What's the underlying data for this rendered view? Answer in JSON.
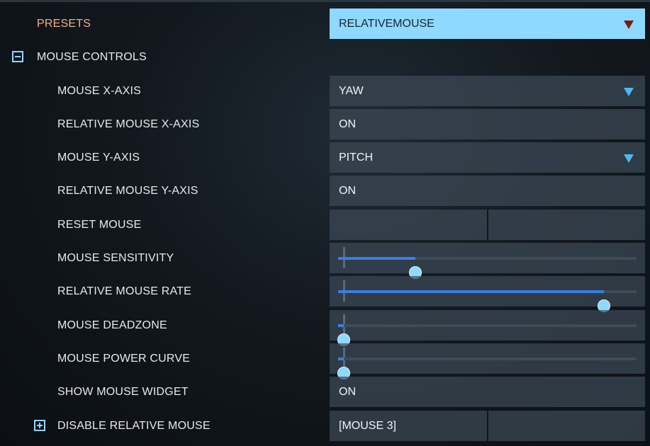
{
  "presets": {
    "label": "PRESETS",
    "value": "RELATIVEMOUSE"
  },
  "section": {
    "label": "MOUSE CONTROLS",
    "expanded": true
  },
  "rows": [
    {
      "label": "MOUSE X-AXIS",
      "value": "YAW"
    },
    {
      "label": "RELATIVE MOUSE X-AXIS",
      "value": "ON"
    },
    {
      "label": "MOUSE Y-AXIS",
      "value": "PITCH"
    },
    {
      "label": "RELATIVE MOUSE Y-AXIS",
      "value": "ON"
    },
    {
      "label": "RESET MOUSE",
      "binding_primary": "",
      "binding_secondary": ""
    },
    {
      "label": "MOUSE SENSITIVITY",
      "level": 0.26
    },
    {
      "label": "RELATIVE MOUSE RATE",
      "level": 0.89
    },
    {
      "label": "MOUSE DEADZONE",
      "level": 0.02
    },
    {
      "label": "MOUSE POWER CURVE",
      "level": 0.02
    },
    {
      "label": "SHOW MOUSE WIDGET",
      "value": "ON"
    },
    {
      "label": "DISABLE RELATIVE MOUSE",
      "binding_primary": "[MOUSE 3]",
      "binding_secondary": ""
    }
  ],
  "colors": {
    "accent": "#8fd8ff",
    "slider_fill": "#3a7de8",
    "presets_label": "#f0b08a",
    "preset_caret": "#7a1a10"
  },
  "icons": {
    "collapse": "minus-box-icon",
    "expand": "plus-box-icon",
    "dropdown": "triangle-down-icon"
  }
}
